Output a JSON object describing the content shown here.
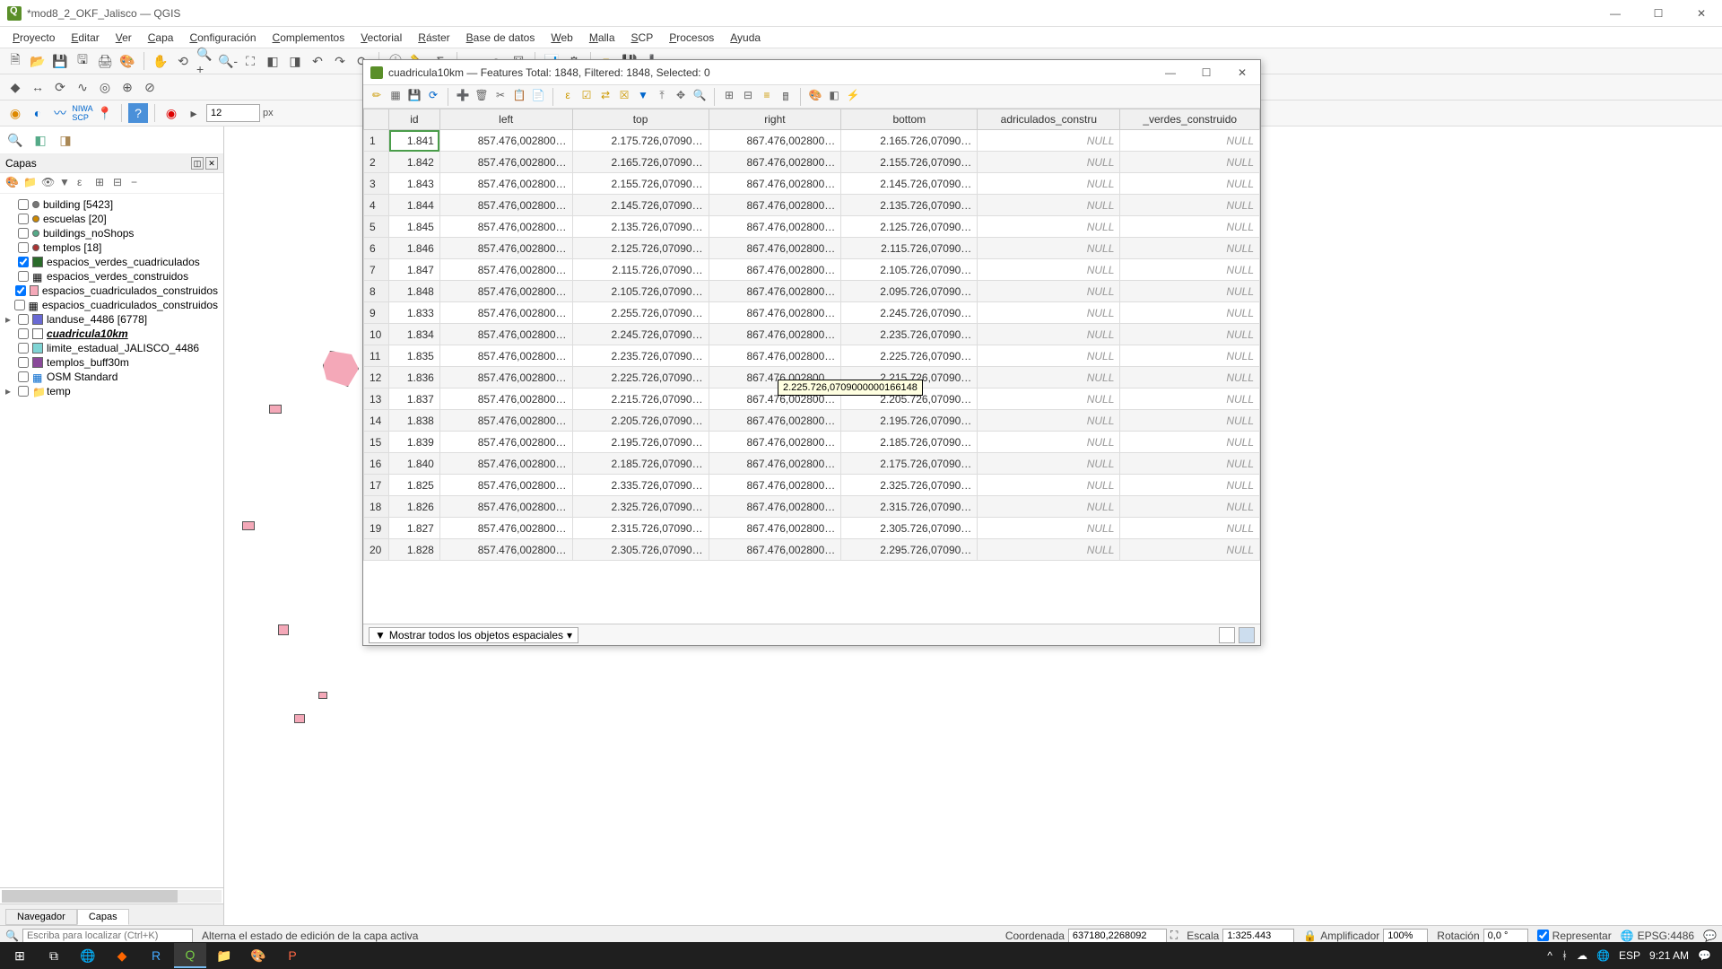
{
  "window": {
    "title": "*mod8_2_OKF_Jalisco — QGIS"
  },
  "menu": [
    "Proyecto",
    "Editar",
    "Ver",
    "Capa",
    "Configuración",
    "Complementos",
    "Vectorial",
    "Ráster",
    "Base de datos",
    "Web",
    "Malla",
    "SCP",
    "Procesos",
    "Ayuda"
  ],
  "toolbar3": {
    "spin_value": "12",
    "spin_unit": "px"
  },
  "layers_panel": {
    "title": "Capas",
    "items": [
      {
        "checked": false,
        "sym_type": "pt",
        "color": "#777",
        "label": "building [5423]"
      },
      {
        "checked": false,
        "sym_type": "pt",
        "color": "#cc8800",
        "label": "escuelas [20]"
      },
      {
        "checked": false,
        "sym_type": "pt",
        "color": "#5a8",
        "label": "buildings_noShops"
      },
      {
        "checked": false,
        "sym_type": "pt",
        "color": "#a33",
        "label": "templos [18]"
      },
      {
        "checked": true,
        "sym_type": "sq",
        "color": "#2a6b2a",
        "label": "espacios_verdes_cuadriculados"
      },
      {
        "checked": false,
        "sym_type": "tb",
        "color": "",
        "label": "espacios_verdes_construidos"
      },
      {
        "checked": true,
        "sym_type": "sq",
        "color": "#f4a8b8",
        "label": "espacios_cuadriculados_construidos"
      },
      {
        "checked": false,
        "sym_type": "tb",
        "color": "",
        "label": "espacios_cuadriculados_construidos"
      },
      {
        "checked": false,
        "sym_type": "sq",
        "color": "#6a6ad4",
        "label": "landuse_4486 [6778]",
        "exp": "▸"
      },
      {
        "checked": false,
        "sym_type": "sq",
        "color": "#fff",
        "label": "cuadricula10km",
        "bold": true
      },
      {
        "checked": false,
        "sym_type": "sq",
        "color": "#7fd4d4",
        "label": "limite_estadual_JALISCO_4486"
      },
      {
        "checked": false,
        "sym_type": "sq",
        "color": "#8a4a9a",
        "label": "templos_buff30m"
      },
      {
        "checked": false,
        "sym_type": "grid",
        "color": "",
        "label": "OSM Standard"
      },
      {
        "checked": false,
        "sym_type": "folder",
        "color": "",
        "label": "temp",
        "exp": "▸"
      }
    ]
  },
  "tabs": {
    "navegador": "Navegador",
    "capas": "Capas"
  },
  "attr": {
    "title": "cuadricula10km — Features Total: 1848, Filtered: 1848, Selected: 0",
    "columns": [
      "id",
      "left",
      "top",
      "right",
      "bottom",
      "adriculados_constru",
      "_verdes_construido"
    ],
    "rows": [
      {
        "n": "1",
        "id": "1.841",
        "left": "857.476,002800…",
        "top": "2.175.726,07090…",
        "right": "867.476,002800…",
        "bottom": "2.165.726,07090…",
        "c6": "NULL",
        "c7": "NULL"
      },
      {
        "n": "2",
        "id": "1.842",
        "left": "857.476,002800…",
        "top": "2.165.726,07090…",
        "right": "867.476,002800…",
        "bottom": "2.155.726,07090…",
        "c6": "NULL",
        "c7": "NULL"
      },
      {
        "n": "3",
        "id": "1.843",
        "left": "857.476,002800…",
        "top": "2.155.726,07090…",
        "right": "867.476,002800…",
        "bottom": "2.145.726,07090…",
        "c6": "NULL",
        "c7": "NULL"
      },
      {
        "n": "4",
        "id": "1.844",
        "left": "857.476,002800…",
        "top": "2.145.726,07090…",
        "right": "867.476,002800…",
        "bottom": "2.135.726,07090…",
        "c6": "NULL",
        "c7": "NULL"
      },
      {
        "n": "5",
        "id": "1.845",
        "left": "857.476,002800…",
        "top": "2.135.726,07090…",
        "right": "867.476,002800…",
        "bottom": "2.125.726,07090…",
        "c6": "NULL",
        "c7": "NULL"
      },
      {
        "n": "6",
        "id": "1.846",
        "left": "857.476,002800…",
        "top": "2.125.726,07090…",
        "right": "867.476,002800…",
        "bottom": "2.115.726,07090…",
        "c6": "NULL",
        "c7": "NULL"
      },
      {
        "n": "7",
        "id": "1.847",
        "left": "857.476,002800…",
        "top": "2.115.726,07090…",
        "right": "867.476,002800…",
        "bottom": "2.105.726,07090…",
        "c6": "NULL",
        "c7": "NULL"
      },
      {
        "n": "8",
        "id": "1.848",
        "left": "857.476,002800…",
        "top": "2.105.726,07090…",
        "right": "867.476,002800…",
        "bottom": "2.095.726,07090…",
        "c6": "NULL",
        "c7": "NULL"
      },
      {
        "n": "9",
        "id": "1.833",
        "left": "857.476,002800…",
        "top": "2.255.726,07090…",
        "right": "867.476,002800…",
        "bottom": "2.245.726,07090…",
        "c6": "NULL",
        "c7": "NULL"
      },
      {
        "n": "10",
        "id": "1.834",
        "left": "857.476,002800…",
        "top": "2.245.726,07090…",
        "right": "867.476,002800…",
        "bottom": "2.235.726,07090…",
        "c6": "NULL",
        "c7": "NULL"
      },
      {
        "n": "11",
        "id": "1.835",
        "left": "857.476,002800…",
        "top": "2.235.726,07090…",
        "right": "867.476,002800…",
        "bottom": "2.225.726,07090…",
        "c6": "NULL",
        "c7": "NULL"
      },
      {
        "n": "12",
        "id": "1.836",
        "left": "857.476,002800…",
        "top": "2.225.726,07090…",
        "right": "867.476,002800…",
        "bottom": "2.215.726,07090…",
        "c6": "NULL",
        "c7": "NULL"
      },
      {
        "n": "13",
        "id": "1.837",
        "left": "857.476,002800…",
        "top": "2.215.726,07090…",
        "right": "867.476,002800…",
        "bottom": "2.205.726,07090…",
        "c6": "NULL",
        "c7": "NULL"
      },
      {
        "n": "14",
        "id": "1.838",
        "left": "857.476,002800…",
        "top": "2.205.726,07090…",
        "right": "867.476,002800…",
        "bottom": "2.195.726,07090…",
        "c6": "NULL",
        "c7": "NULL"
      },
      {
        "n": "15",
        "id": "1.839",
        "left": "857.476,002800…",
        "top": "2.195.726,07090…",
        "right": "867.476,002800…",
        "bottom": "2.185.726,07090…",
        "c6": "NULL",
        "c7": "NULL"
      },
      {
        "n": "16",
        "id": "1.840",
        "left": "857.476,002800…",
        "top": "2.185.726,07090…",
        "right": "867.476,002800…",
        "bottom": "2.175.726,07090…",
        "c6": "NULL",
        "c7": "NULL"
      },
      {
        "n": "17",
        "id": "1.825",
        "left": "857.476,002800…",
        "top": "2.335.726,07090…",
        "right": "867.476,002800…",
        "bottom": "2.325.726,07090…",
        "c6": "NULL",
        "c7": "NULL"
      },
      {
        "n": "18",
        "id": "1.826",
        "left": "857.476,002800…",
        "top": "2.325.726,07090…",
        "right": "867.476,002800…",
        "bottom": "2.315.726,07090…",
        "c6": "NULL",
        "c7": "NULL"
      },
      {
        "n": "19",
        "id": "1.827",
        "left": "857.476,002800…",
        "top": "2.315.726,07090…",
        "right": "867.476,002800…",
        "bottom": "2.305.726,07090…",
        "c6": "NULL",
        "c7": "NULL"
      },
      {
        "n": "20",
        "id": "1.828",
        "left": "857.476,002800…",
        "top": "2.305.726,07090…",
        "right": "867.476,002800…",
        "bottom": "2.295.726,07090…",
        "c6": "NULL",
        "c7": "NULL"
      }
    ],
    "tooltip": "2.225.726,0709000000166148",
    "footer_filter": "Mostrar todos los objetos espaciales"
  },
  "status": {
    "locator_placeholder": "Escriba para localizar (Ctrl+K)",
    "hint": "Alterna el estado de edición de la capa activa",
    "coord_label": "Coordenada",
    "coord_value": "637180,2268092",
    "scale_label": "Escala",
    "scale_value": "1:325.443",
    "mag_label": "Amplificador",
    "mag_value": "100%",
    "rot_label": "Rotación",
    "rot_value": "0,0 °",
    "render": "Representar",
    "crs": "EPSG:4486"
  },
  "tray": {
    "lang": "ESP",
    "time": "9:21 AM"
  }
}
